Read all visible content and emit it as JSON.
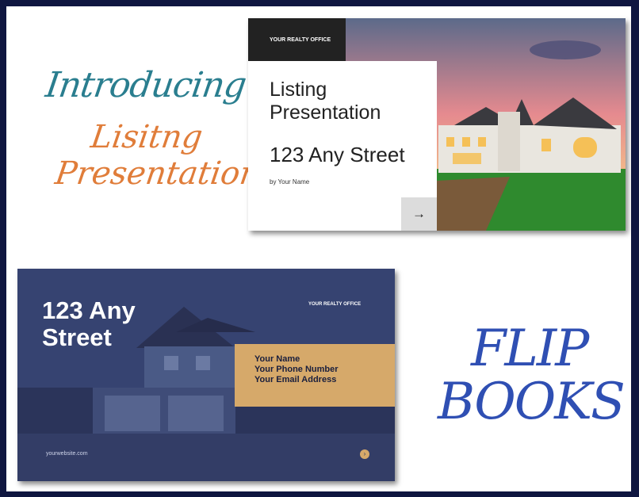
{
  "heading": {
    "line1": "Introducing",
    "line2": "Lisitng",
    "line3": "Presentation"
  },
  "slide1": {
    "office": "YOUR REALTY OFFICE",
    "title": "Listing Presentation",
    "street": "123 Any Street",
    "byline": "by Your Name",
    "arrow_icon": "arrow-right-icon",
    "arrow": "→"
  },
  "slide2": {
    "street": "123 Any Street",
    "office": "YOUR REALTY OFFICE",
    "name": "Your Name",
    "phone": "Your Phone Number",
    "email": "Your Email Address",
    "website": "yourwebsite.com"
  },
  "flipbooks": {
    "line1": "FLIP",
    "line2": "BOOKS"
  },
  "colors": {
    "background": "#0f1640",
    "teal": "#2a7e8f",
    "orange": "#e07d3a",
    "blue": "#2f4fb3",
    "gold": "#d6a96a",
    "navy": "#2e3a63"
  }
}
